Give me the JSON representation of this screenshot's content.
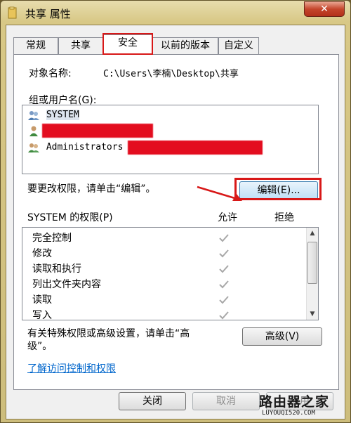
{
  "window": {
    "title": "共享 属性",
    "close_label": "✕"
  },
  "tabs": [
    {
      "label": "常规"
    },
    {
      "label": "共享"
    },
    {
      "label": "安全",
      "active": true
    },
    {
      "label": "以前的版本"
    },
    {
      "label": "自定义"
    }
  ],
  "security": {
    "object_name_label": "对象名称:",
    "object_name_value": "C:\\Users\\李楠\\Desktop\\共享",
    "group_label": "组或用户名(G):",
    "users": [
      {
        "name": "SYSTEM"
      },
      {
        "name": ""
      },
      {
        "name": "Administrators"
      }
    ],
    "change_hint": "要更改权限，请单击“编辑”。",
    "edit_button": "编辑(E)...",
    "perm_header": "SYSTEM 的权限(P)",
    "allow_label": "允许",
    "deny_label": "拒绝",
    "permissions": [
      {
        "name": "完全控制",
        "allow": true
      },
      {
        "name": "修改",
        "allow": true
      },
      {
        "name": "读取和执行",
        "allow": true
      },
      {
        "name": "列出文件夹内容",
        "allow": true
      },
      {
        "name": "读取",
        "allow": true
      },
      {
        "name": "写入",
        "allow": true
      }
    ],
    "advanced_hint_line1": "有关特殊权限或高级设置，请单击“高",
    "advanced_hint_line2": "级”。",
    "advanced_button": "高级(V)",
    "learn_link": "了解访问控制和权限"
  },
  "footer": {
    "close_button": "关闭",
    "cancel_button": "取消",
    "apply_button": "应用"
  },
  "watermark": {
    "logo": "路由器之家",
    "url": "LUYOUQI520.COM"
  },
  "colors": {
    "annotation_red": "#d81818",
    "redaction_red": "#e30d1f",
    "link_blue": "#0066cc"
  }
}
